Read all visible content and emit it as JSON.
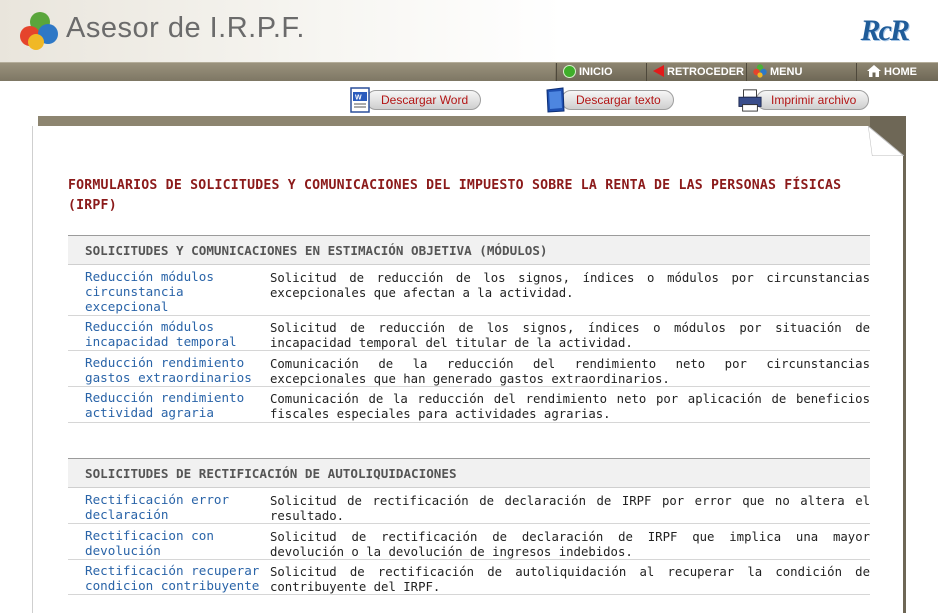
{
  "app": {
    "title": "Asesor de I.R.P.F.",
    "brand": "RcR"
  },
  "nav": [
    {
      "label": "INICIO",
      "icon": "green-circle-icon"
    },
    {
      "label": "RETROCEDER",
      "icon": "red-back-arrow-icon"
    },
    {
      "label": "MENU",
      "icon": "colored-dots-icon"
    },
    {
      "label": "HOME",
      "icon": "house-icon"
    }
  ],
  "downloads": [
    {
      "label": "Descargar Word",
      "icon": "word-document-icon"
    },
    {
      "label": "Descargar texto",
      "icon": "text-document-icon"
    },
    {
      "label": "Imprimir archivo",
      "icon": "printer-icon"
    }
  ],
  "document": {
    "title": "FORMULARIOS DE SOLICITUDES Y COMUNICACIONES DEL IMPUESTO SOBRE LA RENTA DE LAS PERSONAS FÍSICAS (IRPF)",
    "sections": [
      {
        "heading": "SOLICITUDES Y COMUNICACIONES EN ESTIMACIÓN OBJETIVA (MÓDULOS)",
        "rows": [
          {
            "link": "Reducción módulos circunstancia excepcional",
            "desc": "Solicitud de reducción de los signos, índices o módulos por circunstancias excepcionales que afectan a la actividad."
          },
          {
            "link": "Reducción módulos incapacidad temporal",
            "desc": "Solicitud de reducción de los signos, índices o módulos por situación de incapacidad temporal del titular de la actividad."
          },
          {
            "link": "Reducción rendimiento gastos extraordinarios",
            "desc": "Comunicación de la reducción del rendimiento neto por circunstancias excepcionales que han generado gastos extraordinarios."
          },
          {
            "link": "Reducción rendimiento actividad agraria",
            "desc": "Comunicación de la reducción del rendimiento neto por aplicación de beneficios fiscales especiales para actividades agrarias."
          }
        ]
      },
      {
        "heading": "SOLICITUDES DE RECTIFICACIÓN DE AUTOLIQUIDACIONES",
        "rows": [
          {
            "link": "Rectificación error declaración",
            "desc": "Solicitud de rectificación de declaración de IRPF por error que no altera el resultado."
          },
          {
            "link": "Rectificacion con devolución",
            "desc": "Solicitud de rectificación de declaración de IRPF que implica una mayor devolución o la devolución de ingresos indebidos."
          },
          {
            "link": "Rectificación recuperar condicion contribuyente",
            "desc": "Solicitud de rectificación de autoliquidación al recuperar la condición de contribuyente del IRPF."
          }
        ]
      }
    ]
  }
}
